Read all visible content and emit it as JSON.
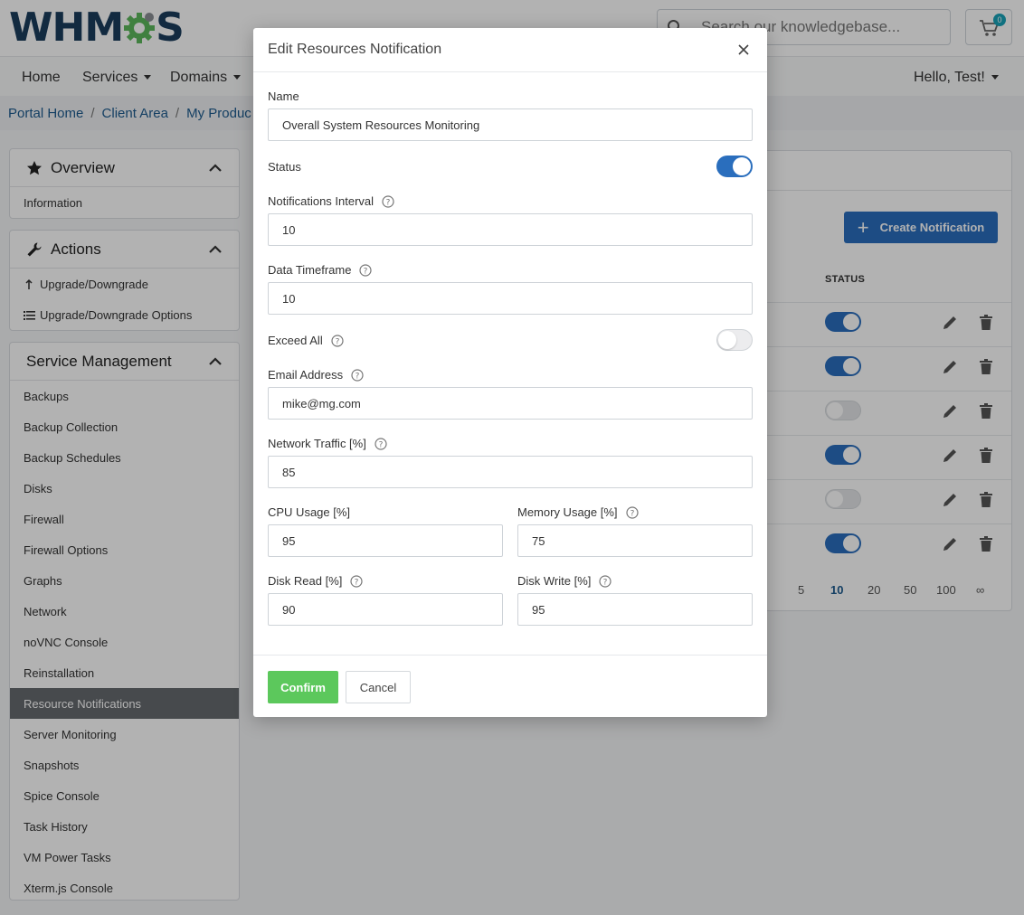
{
  "header": {
    "logo_text_left": "WHM",
    "logo_text_right": "S",
    "search_placeholder": "Search our knowledgebase...",
    "cart_count": "0"
  },
  "nav": {
    "items": [
      "Home",
      "Services",
      "Domains"
    ],
    "greeting": "Hello, Test!"
  },
  "breadcrumb": [
    "Portal Home",
    "Client Area",
    "My Produc"
  ],
  "sidebar": {
    "overview": {
      "title": "Overview",
      "items": [
        "Information"
      ]
    },
    "actions": {
      "title": "Actions",
      "items": [
        "Upgrade/Downgrade",
        "Upgrade/Downgrade Options"
      ]
    },
    "service_management": {
      "title": "Service Management",
      "items": [
        "Backups",
        "Backup Collection",
        "Backup Schedules",
        "Disks",
        "Firewall",
        "Firewall Options",
        "Graphs",
        "Network",
        "noVNC Console",
        "Reinstallation",
        "Resource Notifications",
        "Server Monitoring",
        "Snapshots",
        "Spice Console",
        "Task History",
        "VM Power Tasks",
        "Xterm.js Console"
      ],
      "active": "Resource Notifications"
    }
  },
  "content": {
    "create_button": "Create Notification",
    "status_header": "STATUS",
    "row_status": [
      true,
      true,
      false,
      true,
      false,
      true
    ],
    "pagination": [
      "5",
      "10",
      "20",
      "50",
      "100",
      "∞"
    ],
    "current_page_size": "10"
  },
  "modal": {
    "title": "Edit Resources Notification",
    "name_label": "Name",
    "name_value": "Overall System Resources Monitoring",
    "status_label": "Status",
    "status_on": true,
    "interval_label": "Notifications Interval",
    "interval_value": "10",
    "timeframe_label": "Data Timeframe",
    "timeframe_value": "10",
    "exceed_all_label": "Exceed All",
    "exceed_all_on": false,
    "email_label": "Email Address",
    "email_value": "mike@mg.com",
    "network_label": "Network Traffic [%]",
    "network_value": "85",
    "cpu_label": "CPU Usage [%]",
    "cpu_value": "95",
    "memory_label": "Memory Usage [%]",
    "memory_value": "75",
    "disk_read_label": "Disk Read [%]",
    "disk_read_value": "90",
    "disk_write_label": "Disk Write [%]",
    "disk_write_value": "95",
    "confirm_label": "Confirm",
    "cancel_label": "Cancel"
  },
  "colors": {
    "primary": "#2a6ebd",
    "confirm": "#5cc85c",
    "logo_dark": "#1a3d5c",
    "logo_gear": "#5cb85c",
    "active_side": "#666a6f"
  }
}
